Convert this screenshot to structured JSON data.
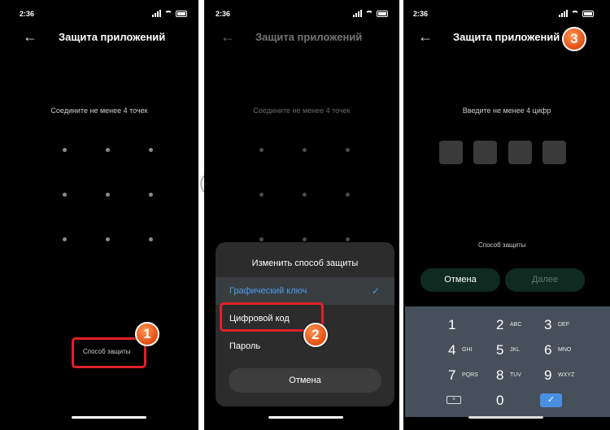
{
  "status": {
    "time": "2:36"
  },
  "screen1": {
    "title": "Защита приложений",
    "hint": "Соедините не менее 4 точек",
    "protection_method": "Способ защиты",
    "marker": "1"
  },
  "screen2": {
    "title": "Защита приложений",
    "hint": "Соедините не менее 4 точек",
    "paren": "(",
    "sheet": {
      "title": "Изменить способ защиты",
      "options": [
        "Графический ключ",
        "Цифровой код",
        "Пароль"
      ],
      "selected": "Графический ключ",
      "cancel": "Отмена"
    },
    "marker": "2"
  },
  "screen3": {
    "title": "Защита приложений",
    "hint": "Введите не менее 4 цифр",
    "protection_method": "Способ защиты",
    "cancel": "Отмена",
    "next": "Далее",
    "marker": "3",
    "keypad": [
      {
        "digit": "1",
        "letters": ""
      },
      {
        "digit": "2",
        "letters": "ABC"
      },
      {
        "digit": "3",
        "letters": "DEF"
      },
      {
        "digit": "4",
        "letters": "GHI"
      },
      {
        "digit": "5",
        "letters": "JKL"
      },
      {
        "digit": "6",
        "letters": "MNO"
      },
      {
        "digit": "7",
        "letters": "PQRS"
      },
      {
        "digit": "8",
        "letters": "TUV"
      },
      {
        "digit": "9",
        "letters": "WXYZ"
      },
      {
        "digit": "0",
        "letters": ""
      }
    ],
    "backspace_symbol": "×",
    "ok_symbol": "✓"
  },
  "icons": {
    "back": "back-arrow-icon",
    "check": "checkmark-icon"
  },
  "colors": {
    "highlight": "#e0202a",
    "marker": "#e24d13",
    "accent_blue": "#4a9ee8",
    "cancel_green_bg": "#0f2a20"
  }
}
